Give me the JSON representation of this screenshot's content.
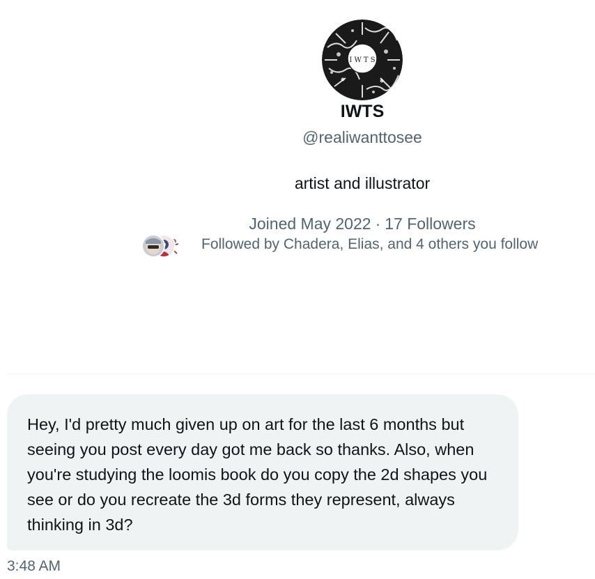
{
  "profile": {
    "avatar_letters": "I W T S",
    "display_name": "IWTS",
    "handle": "@realiwanttosee",
    "bio": "artist and illustrator",
    "joined": "Joined May 2022",
    "separator": "·",
    "followers": "17 Followers",
    "followed_by": "Followed by Chadera, Elias, and 4 others you follow"
  },
  "conversation": {
    "messages": [
      {
        "text": "Hey, I'd pretty much given up on art for the last 6 months but seeing you post every day got me back so thanks. Also, when you're studying the loomis book do you copy the 2d shapes you see or do you recreate the 3d forms they represent, always thinking in 3d?",
        "time": "3:48 AM"
      }
    ]
  },
  "colors": {
    "primary_text": "#0f1419",
    "secondary_text": "#536471",
    "bubble_background": "#eff3f4"
  }
}
